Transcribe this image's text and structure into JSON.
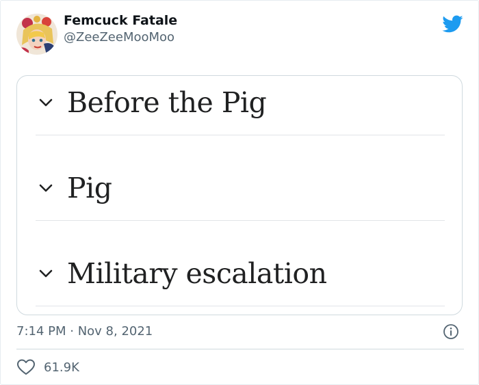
{
  "tweet": {
    "display_name": "Femcuck Fatale",
    "handle": "@ZeeZeeMooMoo",
    "timestamp": "7:14 PM · Nov 8, 2021",
    "like_count": "61.9K"
  },
  "media": {
    "toc_items": [
      {
        "label": "Before the Pig",
        "icon": "chevron-down-icon"
      },
      {
        "label": "Pig",
        "icon": "chevron-down-icon"
      },
      {
        "label": "Military escalation",
        "icon": "chevron-down-icon"
      }
    ]
  },
  "icons": {
    "brand": "twitter-bird-icon",
    "info": "info-icon",
    "like": "heart-icon"
  },
  "colors": {
    "brand": "#1d9bf0",
    "secondary_text": "#536471",
    "primary_text": "#0f1419",
    "border": "#cfd9de"
  }
}
